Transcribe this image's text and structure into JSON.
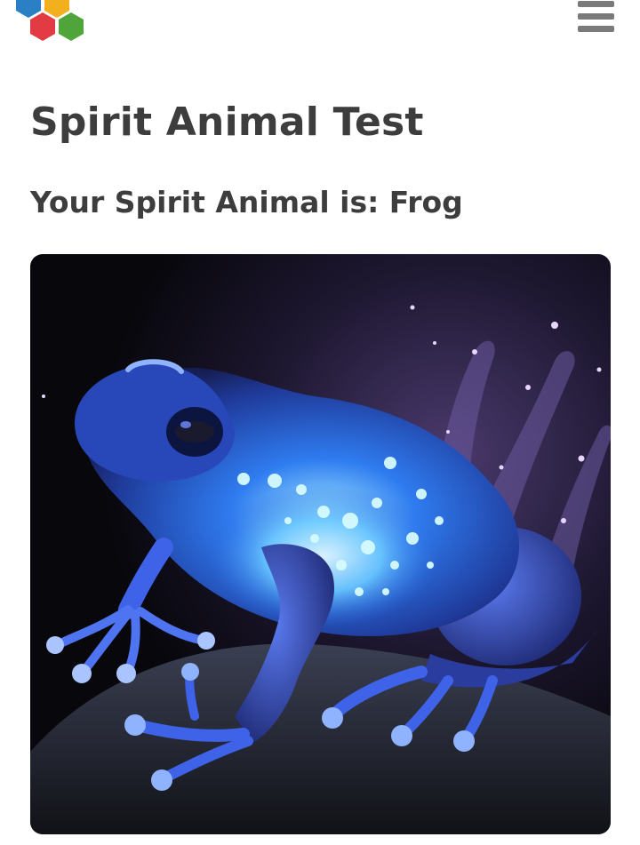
{
  "header": {
    "logo_icon": "hexagon-cluster-logo-icon",
    "logo_colors": [
      "#2b7fc4",
      "#f2b01e",
      "#e23b43",
      "#4fa53a"
    ],
    "menu_icon": "hamburger-menu-icon"
  },
  "main": {
    "title": "Spirit Animal Test",
    "result_heading": "Your Spirit Animal is: Frog",
    "result_image_subject": "glowing-blue-frog-illustration"
  }
}
